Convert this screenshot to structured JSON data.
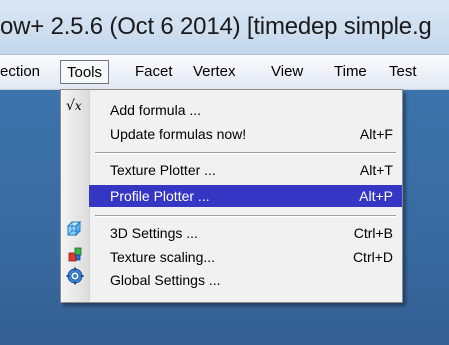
{
  "window": {
    "title": "ow+ 2.5.6 (Oct  6 2014) [timedep simple.g"
  },
  "menubar": {
    "items": [
      {
        "label": "ection"
      },
      {
        "label": "Tools"
      },
      {
        "label": "Facet"
      },
      {
        "label": "Vertex"
      },
      {
        "label": "View"
      },
      {
        "label": "Time"
      },
      {
        "label": "Test"
      }
    ]
  },
  "tools_menu": {
    "items": [
      {
        "label": "Add formula ...",
        "shortcut": "",
        "icon": "sqrt-x-icon"
      },
      {
        "label": "Update formulas now!",
        "shortcut": "Alt+F",
        "icon": ""
      },
      {
        "label": "Texture Plotter ...",
        "shortcut": "Alt+T",
        "icon": ""
      },
      {
        "label": "Profile Plotter ...",
        "shortcut": "Alt+P",
        "icon": "",
        "highlighted": true
      },
      {
        "label": "3D Settings ...",
        "shortcut": "Ctrl+B",
        "icon": "cube-icon"
      },
      {
        "label": "Texture scaling...",
        "shortcut": "Ctrl+D",
        "icon": "texture-scaling-icon"
      },
      {
        "label": "Global Settings ...",
        "shortcut": "",
        "icon": "gear-icon"
      }
    ]
  },
  "colors": {
    "highlight": "#3636c4",
    "workspace": "#3b6a9c",
    "menu_bg": "#f1f1f1"
  }
}
